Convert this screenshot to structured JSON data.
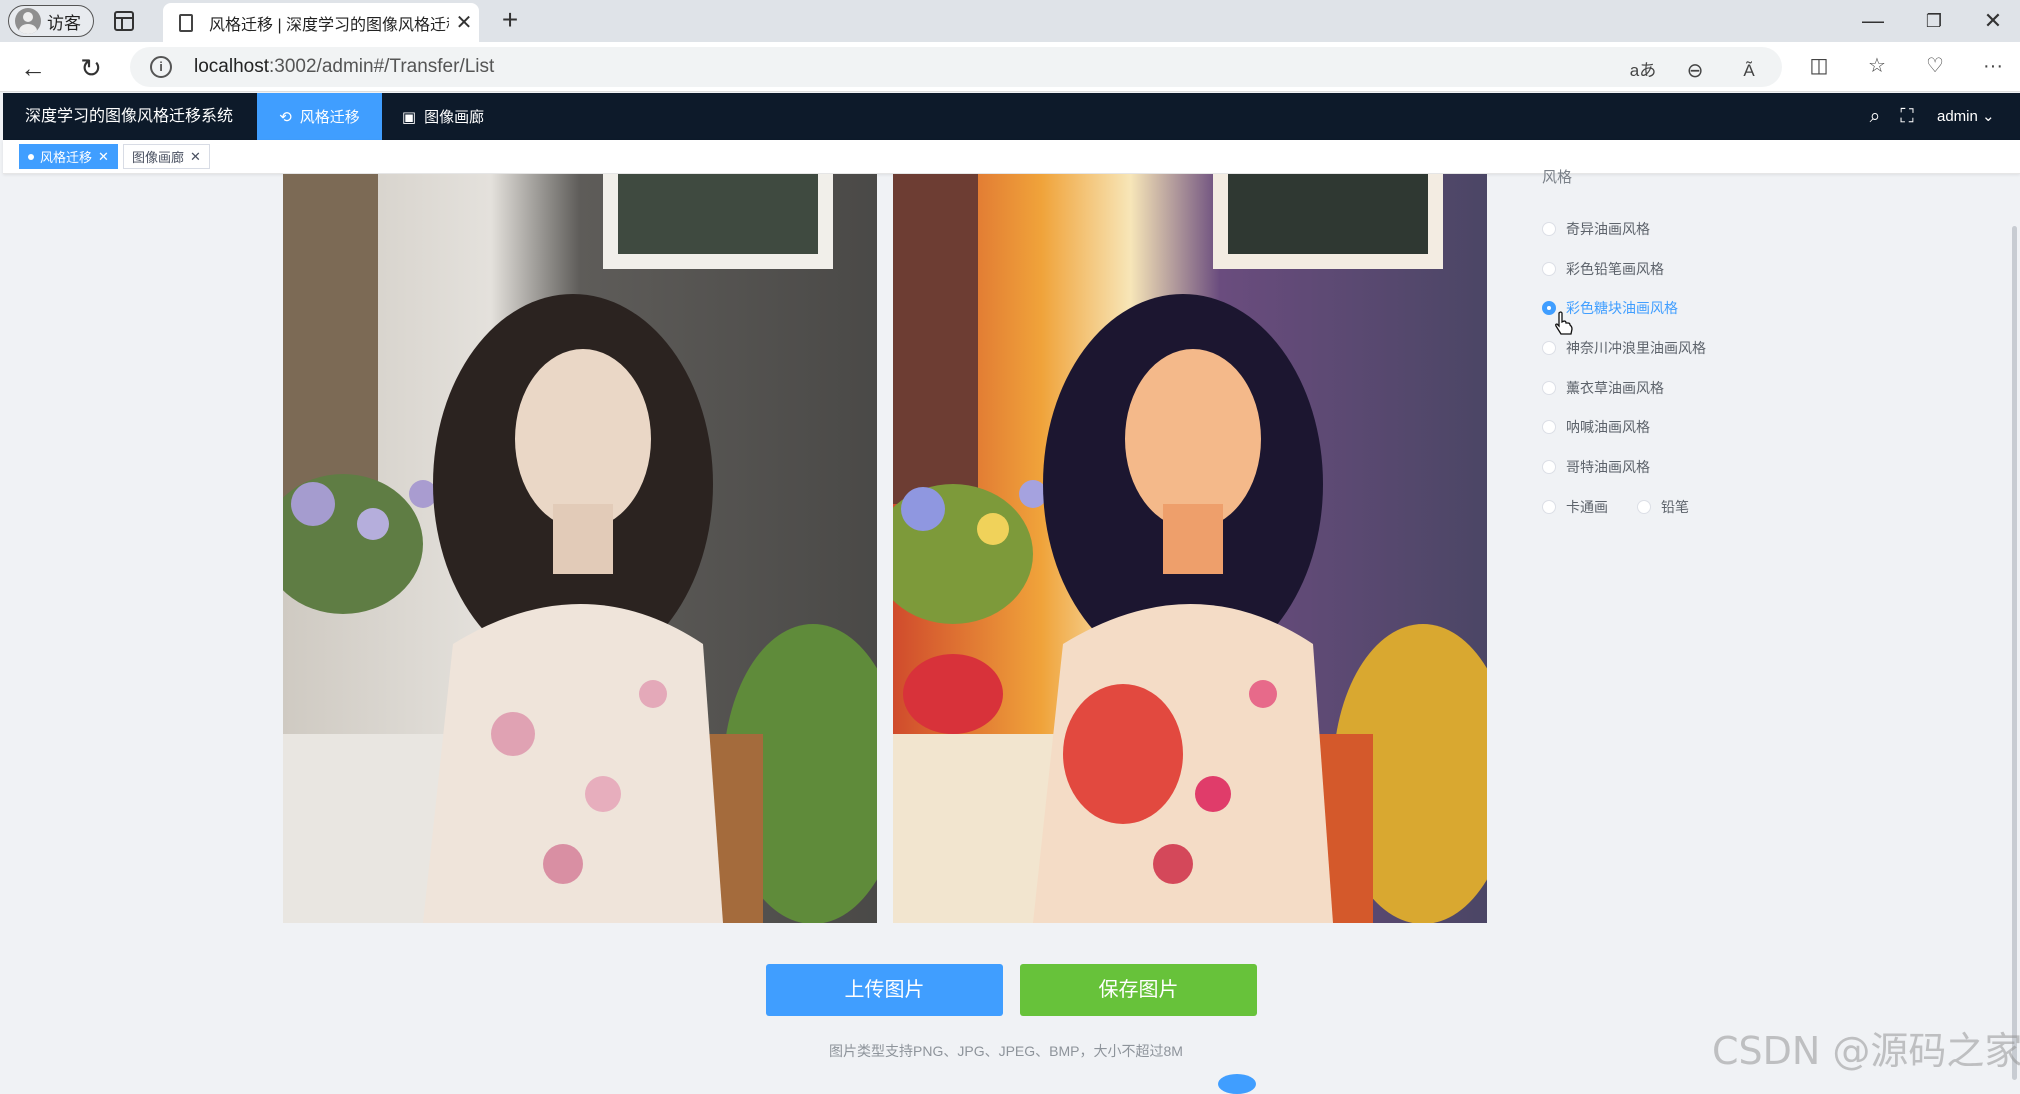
{
  "browser": {
    "profile_label": "访客",
    "tab_title": "风格迁移 | 深度学习的图像风格迁移系统",
    "url_host": "localhost",
    "url_path": ":3002/admin#/Transfer/List",
    "translate_glyph": "aあ",
    "read_aloud_glyph": "Ã"
  },
  "app": {
    "title": "深度学习的图像风格迁移系统",
    "menu": [
      {
        "label": "风格迁移",
        "icon": "transfer-icon",
        "active": true
      },
      {
        "label": "图像画廊",
        "icon": "picture-icon",
        "active": false
      }
    ],
    "user": "admin"
  },
  "tags": [
    {
      "label": "风格迁移",
      "active": true
    },
    {
      "label": "图像画廊",
      "active": false
    }
  ],
  "style_panel": {
    "label": "风格",
    "options": [
      "奇异油画风格",
      "彩色铅笔画风格",
      "彩色糖块油画风格",
      "神奈川冲浪里油画风格",
      "薰衣草油画风格",
      "呐喊油画风格",
      "哥特油画风格",
      "卡通画",
      "铅笔"
    ],
    "selected": "彩色糖块油画风格"
  },
  "actions": {
    "upload_label": "上传图片",
    "save_label": "保存图片",
    "hint": "图片类型支持PNG、JPG、JPEG、BMP，大小不超过8M"
  },
  "watermark": "CSDN @源码之家",
  "colors": {
    "header_bg": "#0d1a2a",
    "accent": "#409eff",
    "save_green": "#67c23a"
  }
}
